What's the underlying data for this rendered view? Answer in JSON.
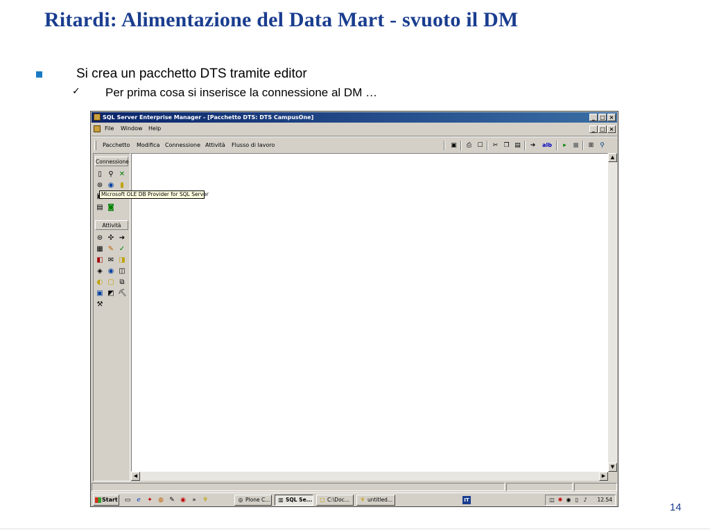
{
  "slide": {
    "title": "Ritardi: Alimentazione del Data Mart - svuoto il DM",
    "bullet_1": "Si crea un pacchetto DTS tramite editor",
    "bullet_2_check": "✓",
    "bullet_2": "Per prima cosa si inserisce la connessione al DM …",
    "page_number": "14"
  },
  "window": {
    "title": "SQL Server Enterprise Manager - [Pacchetto DTS: DTS CampusOne]",
    "title_buttons": [
      "_",
      "□",
      "×"
    ],
    "menu": [
      "File",
      "Window",
      "Help"
    ],
    "mdi_buttons": [
      "_",
      "□",
      "×"
    ],
    "toolbar_menu": [
      "Pacchetto",
      "Modifica",
      "Connessione",
      "Attività",
      "Flusso di lavoro"
    ],
    "toolbar_icons": [
      "save-icon",
      "print-icon",
      "properties-icon",
      "cut-icon",
      "copy-icon",
      "paste-icon",
      "execute-icon",
      "align-icon",
      "run-icon",
      "stop-icon",
      "layout-icon",
      "zoom-icon"
    ],
    "toolbar_text": "alb"
  },
  "palette": {
    "connection_header": "Connessione",
    "tasks_header": "Attività",
    "tooltip": "Microsoft OLE DB Provider for SQL Server"
  },
  "taskbar": {
    "start": "Start",
    "tasks": [
      {
        "label": "Plone C...",
        "active": false
      },
      {
        "label": "SQL Se...",
        "active": true
      },
      {
        "label": "C:\\Doc...",
        "active": false
      },
      {
        "label": "untitled...",
        "active": false
      }
    ],
    "language": "IT",
    "clock": "12.54"
  },
  "colors": {
    "title": "#1a3d8f",
    "bullet": "#1a7bc4",
    "titlebar_start": "#0a246a",
    "titlebar_end": "#3a6ea5",
    "window_face": "#d4d0c8"
  }
}
